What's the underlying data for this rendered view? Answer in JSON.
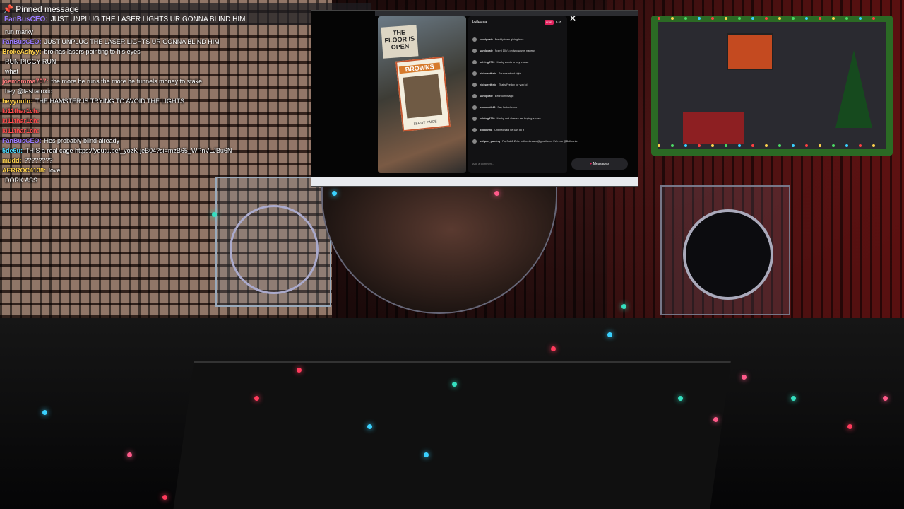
{
  "pinned": {
    "header": "Pinned message",
    "user": "FanBusCEO:",
    "text": "JUST UNPLUG THE LASER LIGHTS UR GONNA BLIND HIM"
  },
  "chat": [
    {
      "user": "",
      "text": "run marky",
      "color": "#9c7cff"
    },
    {
      "user": "FanBusCEO:",
      "text": "JUST UNPLUG THE LASER LIGHTS UR GONNA BLIND HIM",
      "color": "#9c7cff"
    },
    {
      "user": "BrokeAshyy:",
      "text": "bro has lasers pointing to his eyes",
      "color": "#ffd24d"
    },
    {
      "user": "",
      "text": "RUN PIGGY RUN",
      "color": "#ff8c2a"
    },
    {
      "user": "",
      "text": "what",
      "color": "#4cd964"
    },
    {
      "user": "joemomma707:",
      "text": "the more he runs the more he funnels money to stake",
      "color": "#ff7f7f"
    },
    {
      "user": "",
      "text": "hey @tashatoxic",
      "color": "#4a7dff"
    },
    {
      "user": "heyyouto:",
      "text": "THE HAMSTER IS TRYING TO AVOID THE LIGHTS",
      "color": "#ffd24d"
    },
    {
      "user": "ki11thar1ch:",
      "text": "",
      "color": "#ff4d4d"
    },
    {
      "user": "ki11thar1ch:",
      "text": "",
      "color": "#ff4d4d"
    },
    {
      "user": "ki11thar1ch:",
      "text": "",
      "color": "#ff4d4d"
    },
    {
      "user": "FanBusCEO:",
      "text": "Hes probably blind already",
      "color": "#9c7cff"
    },
    {
      "user": "5de6u:",
      "text": "THIS a real cage https://youtu.be/_yozK-jeB04?si=mzB65_WPnVLJBu6N",
      "color": "#4ddbff"
    },
    {
      "user": "mudd:",
      "text": "????????",
      "color": "#ffd24d"
    },
    {
      "user": "AERROC4138:",
      "text": "love",
      "color": "#ffd24d"
    },
    {
      "user": "",
      "text": "DORK ASS",
      "color": "#ff8c2a"
    }
  ],
  "overlay": {
    "close_glyph": "✕",
    "video": {
      "sign_text": "THE FLOOR IS OPEN",
      "card_team": "BROWNS",
      "card_name": "LEROY PAIGE"
    },
    "stream": {
      "username": "bullponia",
      "live_badge": "LIVE",
      "viewer_count": "6.1K",
      "comments": [
        {
          "user": "sandgoatz",
          "text": "Freddy been giving hers"
        },
        {
          "user": "sandgoatz",
          "text": "Spent 10k's on two warns naperct"
        },
        {
          "user": "kelving9720",
          "text": "Marky wants to buy a case"
        },
        {
          "user": "nickweetfield",
          "text": "Sounds about right"
        },
        {
          "user": "nickweetfield",
          "text": "That's Freddy for you lol"
        },
        {
          "user": "sandgoatz",
          "text": "Bedroom magic"
        },
        {
          "user": "beaumnth48",
          "text": "Say fuck chenzo"
        },
        {
          "user": "kelving9720",
          "text": "Marky and chenzo are buying a case"
        },
        {
          "user": "ggconnna",
          "text": "Chenzo said he can do it"
        },
        {
          "user": "bullpen_gaming",
          "text": "PayPal & Zelle bullpenbreaks@gmail.com / Venmo @Bullponia"
        }
      ],
      "input_placeholder": "Add a comment...",
      "messages_label": "Messages"
    }
  }
}
